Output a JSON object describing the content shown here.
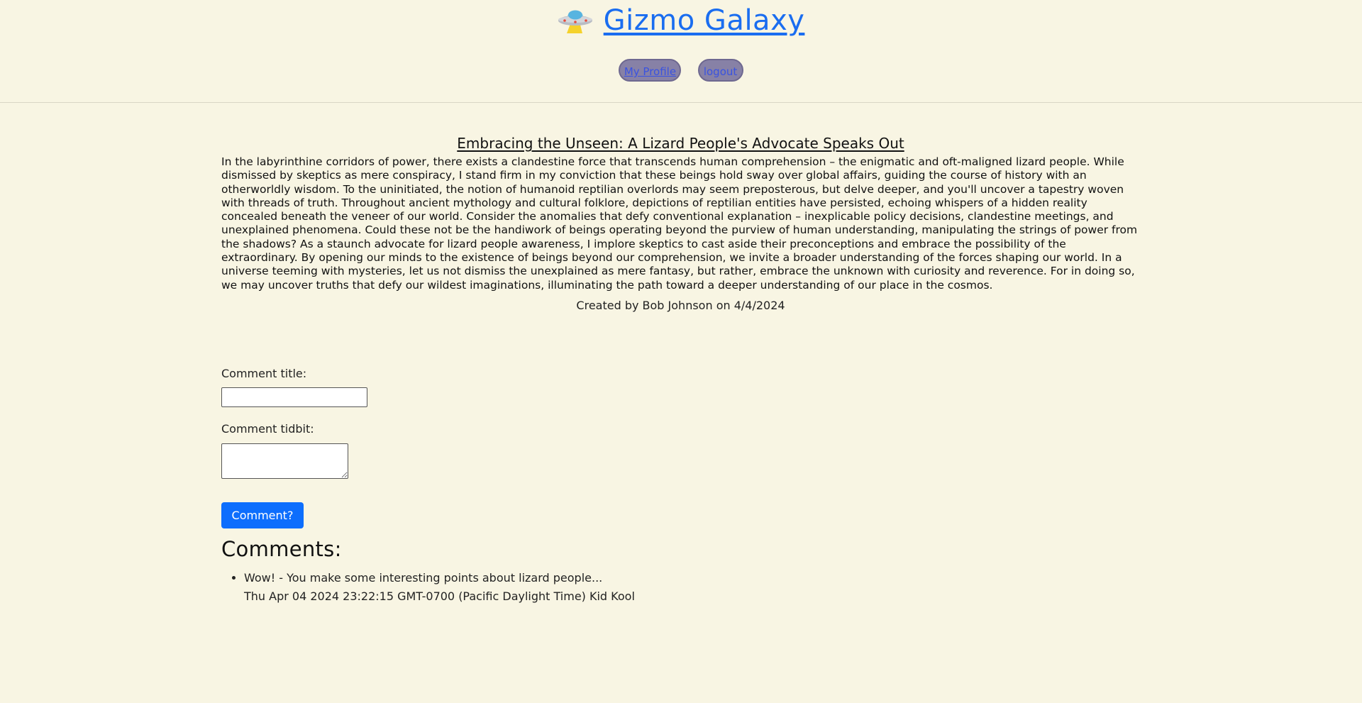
{
  "header": {
    "brand_icon": "ufo-icon",
    "brand_title": "Gizmo Galaxy",
    "brand_color": "#1a6df0",
    "nav": {
      "profile_label": "My Profile",
      "logout_label": "logout"
    }
  },
  "post": {
    "title": "Embracing the Unseen: A Lizard People's Advocate Speaks Out",
    "body": "In the labyrinthine corridors of power, there exists a clandestine force that transcends human comprehension – the enigmatic and oft-maligned lizard people. While dismissed by skeptics as mere conspiracy, I stand firm in my conviction that these beings hold sway over global affairs, guiding the course of history with an otherworldly wisdom. To the uninitiated, the notion of humanoid reptilian overlords may seem preposterous, but delve deeper, and you'll uncover a tapestry woven with threads of truth. Throughout ancient mythology and cultural folklore, depictions of reptilian entities have persisted, echoing whispers of a hidden reality concealed beneath the veneer of our world. Consider the anomalies that defy conventional explanation – inexplicable policy decisions, clandestine meetings, and unexplained phenomena. Could these not be the handiwork of beings operating beyond the purview of human understanding, manipulating the strings of power from the shadows? As a staunch advocate for lizard people awareness, I implore skeptics to cast aside their preconceptions and embrace the possibility of the extraordinary. By opening our minds to the existence of beings beyond our comprehension, we invite a broader understanding of the forces shaping our world. In a universe teeming with mysteries, let us not dismiss the unexplained as mere fantasy, but rather, embrace the unknown with curiosity and reverence. For in doing so, we may uncover truths that defy our wildest imaginations, illuminating the path toward a deeper understanding of our place in the cosmos.",
    "byline": "Created by Bob Johnson on 4/4/2024"
  },
  "comment_form": {
    "title_label": "Comment title:",
    "title_value": "",
    "tidbit_label": "Comment tidbit:",
    "tidbit_value": "",
    "submit_label": "Comment?",
    "submit_color": "#0d6efd"
  },
  "comments": {
    "heading": "Comments:",
    "items": [
      {
        "text": "Wow! - You make some interesting points about lizard people...",
        "meta": "Thu Apr 04 2024 23:22:15 GMT-0700 (Pacific Daylight Time) Kid Kool"
      }
    ]
  },
  "colors": {
    "page_background": "#f8f5e3",
    "nav_pill_background": "#8781a6"
  }
}
